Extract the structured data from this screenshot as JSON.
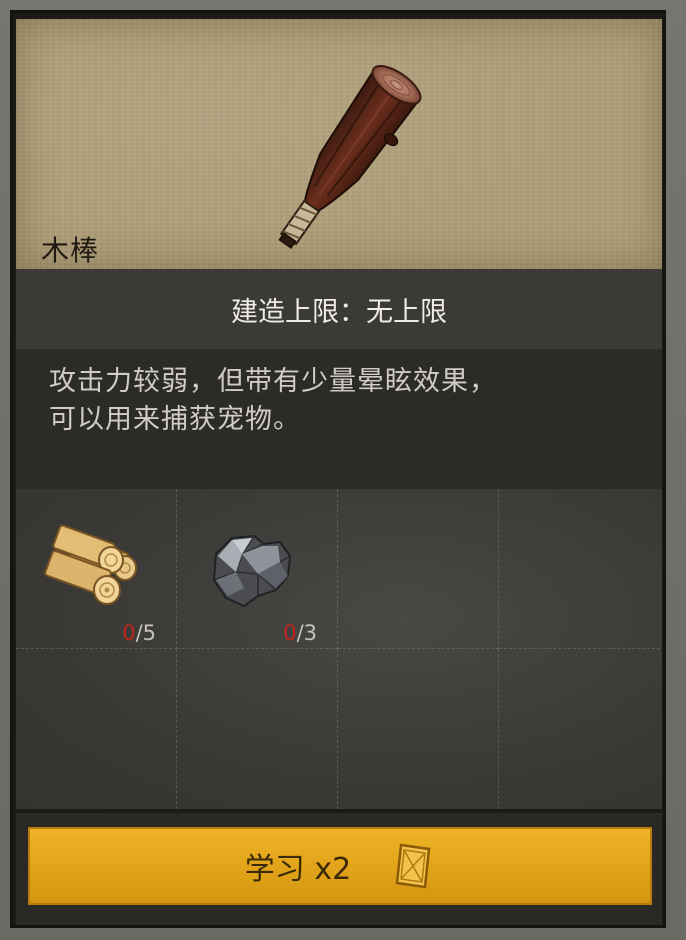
{
  "item": {
    "name": "木棒",
    "icon": "wooden-club-icon"
  },
  "build_limit": {
    "text": "建造上限：无上限"
  },
  "description": {
    "line1": "攻击力较弱，但带有少量晕眩效果，",
    "line2": "可以用来捕获宠物。"
  },
  "materials": [
    {
      "icon": "wood-log-icon",
      "have": "0",
      "need": "/5"
    },
    {
      "icon": "stone-ore-icon",
      "have": "0",
      "need": "/3"
    }
  ],
  "learn_button": {
    "label": "学习 x2",
    "icon": "blueprint-token-icon"
  },
  "colors": {
    "accent_button": "#e2a41a",
    "insufficient": "#c0241c"
  }
}
